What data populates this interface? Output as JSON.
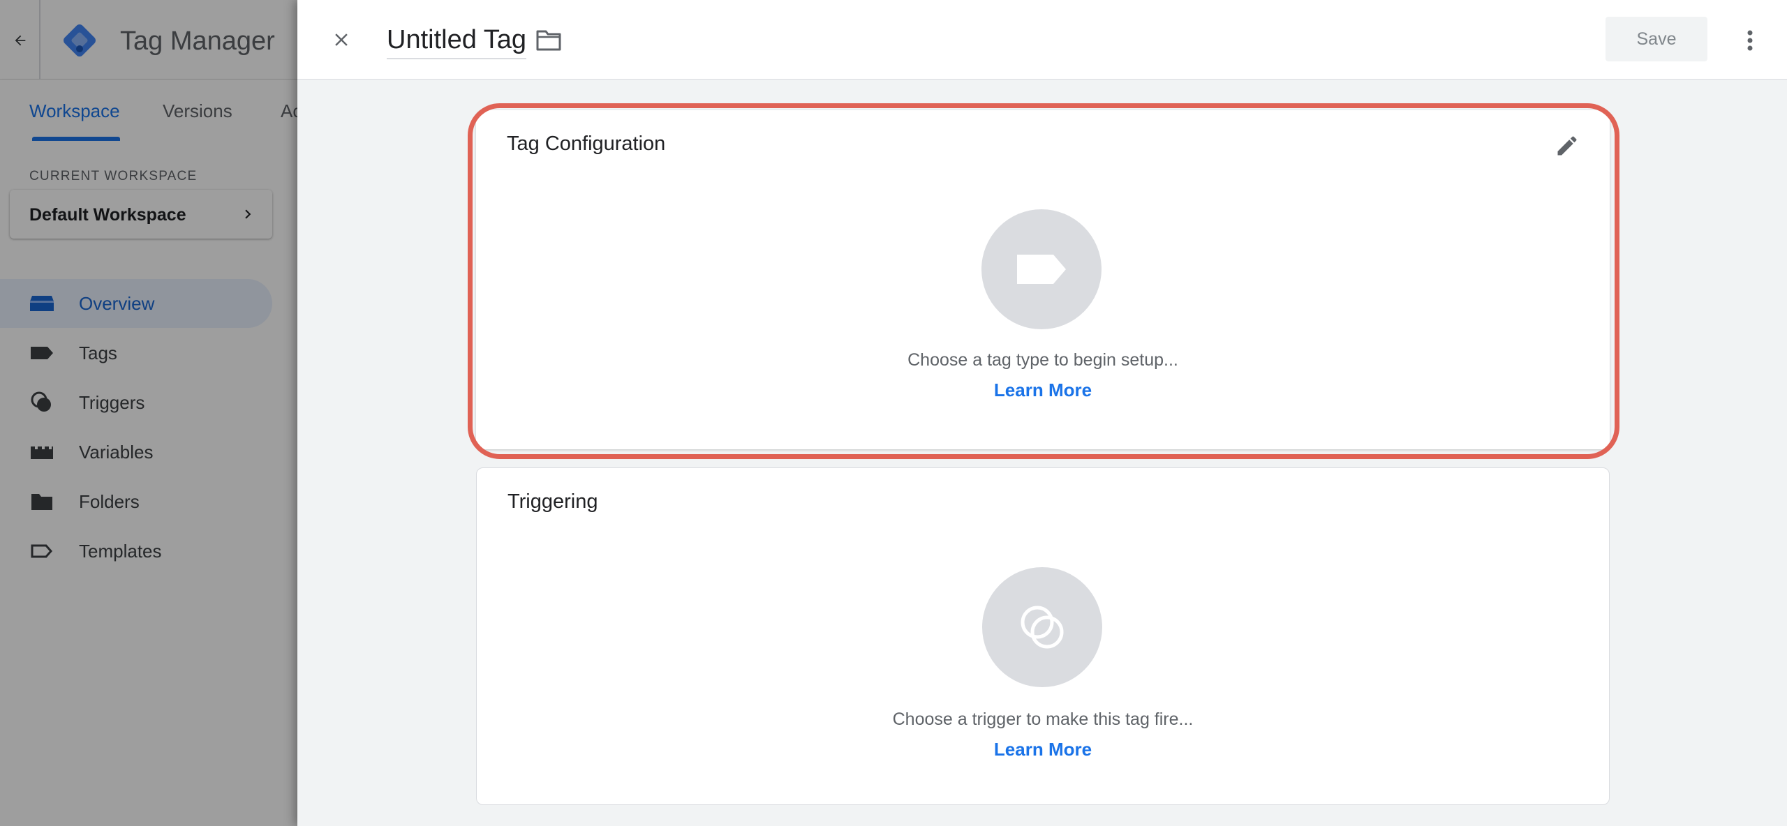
{
  "app": {
    "product_name": "Tag Manager",
    "tabs": [
      {
        "label": "Workspace"
      },
      {
        "label": "Versions"
      },
      {
        "label": "Ac"
      }
    ]
  },
  "sidebar": {
    "workspace_label": "CURRENT WORKSPACE",
    "workspace_name": "Default Workspace",
    "items": [
      {
        "label": "Overview",
        "icon": "overview-icon"
      },
      {
        "label": "Tags",
        "icon": "tag-icon"
      },
      {
        "label": "Triggers",
        "icon": "trigger-icon"
      },
      {
        "label": "Variables",
        "icon": "variables-icon"
      },
      {
        "label": "Folders",
        "icon": "folder-icon"
      },
      {
        "label": "Templates",
        "icon": "template-icon"
      }
    ]
  },
  "panel": {
    "title": "Untitled Tag",
    "save_label": "Save",
    "config_card": {
      "title": "Tag Configuration",
      "hint": "Choose a tag type to begin setup...",
      "link": "Learn More"
    },
    "trigger_card": {
      "title": "Triggering",
      "hint": "Choose a trigger to make this tag fire...",
      "link": "Learn More"
    }
  },
  "colors": {
    "accent": "#1a73e8",
    "highlight_ring": "#e06255",
    "icon_circle": "#dadce0"
  }
}
